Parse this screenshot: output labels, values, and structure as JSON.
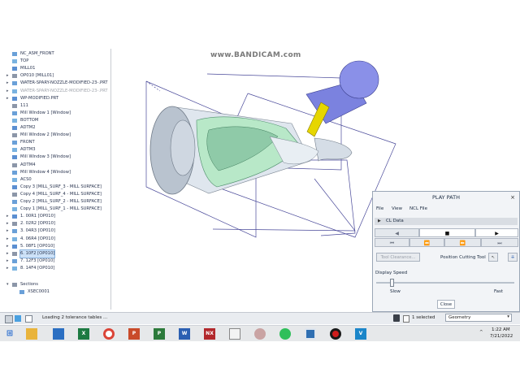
{
  "watermark": "www.BANDICAM.com",
  "tree": {
    "items": [
      {
        "label": "NC_ASM_FRONT",
        "expander": "",
        "dim": false,
        "selected": false
      },
      {
        "label": "TOP",
        "expander": "",
        "dim": false,
        "selected": false
      },
      {
        "label": "MILL01",
        "expander": "",
        "dim": false,
        "selected": false
      },
      {
        "label": "OP010 [MILL01]",
        "expander": "▸",
        "dim": false,
        "selected": false
      },
      {
        "label": "WATER-SPARY-NOZZLE-MODIFIED-23-.PRT",
        "expander": "▸",
        "dim": false,
        "selected": false
      },
      {
        "label": "WATER-SPARY-NOZZLE-MODIFIED-23-.PRT",
        "expander": "▸",
        "dim": true,
        "selected": false
      },
      {
        "label": "WP-MODIFIED.PRT",
        "expander": "▸",
        "dim": false,
        "selected": false
      },
      {
        "label": "111",
        "expander": "",
        "dim": false,
        "selected": false
      },
      {
        "label": "Mill Window 1 [Window]",
        "expander": "",
        "dim": false,
        "selected": false
      },
      {
        "label": "BOTTOM",
        "expander": "",
        "dim": false,
        "selected": false
      },
      {
        "label": "ADTM2",
        "expander": "",
        "dim": false,
        "selected": false
      },
      {
        "label": "Mill Window 2 [Window]",
        "expander": "",
        "dim": false,
        "selected": false
      },
      {
        "label": "FRONT",
        "expander": "",
        "dim": false,
        "selected": false
      },
      {
        "label": "ADTM3",
        "expander": "",
        "dim": false,
        "selected": false
      },
      {
        "label": "Mill Window 3 [Window]",
        "expander": "",
        "dim": false,
        "selected": false
      },
      {
        "label": "ADTM4",
        "expander": "",
        "dim": false,
        "selected": false
      },
      {
        "label": "Mill Window 4 [Window]",
        "expander": "",
        "dim": false,
        "selected": false
      },
      {
        "label": "ACS0",
        "expander": "",
        "dim": false,
        "selected": false
      },
      {
        "label": "Copy 3 [MILL_SURF_3 - MILL SURFACE]",
        "expander": "",
        "dim": false,
        "selected": false
      },
      {
        "label": "Copy 4 [MILL_SURF_4 - MILL SURFACE]",
        "expander": "",
        "dim": false,
        "selected": false
      },
      {
        "label": "Copy 2 [MILL_SURF_2 - MILL SURFACE]",
        "expander": "",
        "dim": false,
        "selected": false
      },
      {
        "label": "Copy 1 [MILL_SURF_1 - MILL SURFACE]",
        "expander": "",
        "dim": false,
        "selected": false
      },
      {
        "label": "1. 00R1 [OP010]",
        "expander": "▸",
        "dim": false,
        "selected": false
      },
      {
        "label": "2. 02R2 [OP010]",
        "expander": "▸",
        "dim": false,
        "selected": false
      },
      {
        "label": "3. 04R3 [OP010]",
        "expander": "▸",
        "dim": false,
        "selected": false
      },
      {
        "label": "4. 06R4 [OP010]",
        "expander": "▸",
        "dim": false,
        "selected": false
      },
      {
        "label": "5. 08F1 [OP010]",
        "expander": "▸",
        "dim": false,
        "selected": false
      },
      {
        "label": "6. 10F2 [OP010]",
        "expander": "▸",
        "dim": false,
        "selected": true
      },
      {
        "label": "7. 12F3 [OP010]",
        "expander": "▸",
        "dim": false,
        "selected": false
      },
      {
        "label": "8. 14F4 [OP010]",
        "expander": "▸",
        "dim": false,
        "selected": false
      }
    ],
    "sections_label": "Sections",
    "section_item": "XSEC0001"
  },
  "play_path": {
    "title": "PLAY PATH",
    "close_glyph": "×",
    "menu": [
      "File",
      "View",
      "NCL File"
    ],
    "cl_data_label": "CL Data",
    "tool_clearance_label": "Tool Clearance...",
    "position_cutting_tool_label": "Position Cutting Tool",
    "display_speed_label": "Display Speed",
    "speed_level": 0.1,
    "slow_label": "Slow",
    "fast_label": "Fast",
    "close_button_label": "Close"
  },
  "status_bar": {
    "message": "Loading 2 tolerance tables ...",
    "selected_count": "1 selected",
    "filter_value": "Geometry"
  },
  "taskbar": {
    "time": "1:22 AM",
    "date": "7/21/2022"
  },
  "colors": {
    "part_body": "#dfe6ee",
    "part_green": "#b8e8c8",
    "tool_holder": "#8a90e8",
    "tool_tip": "#e6d600",
    "selection": "#cde2f8",
    "window_lines": "#4a4a9a"
  }
}
